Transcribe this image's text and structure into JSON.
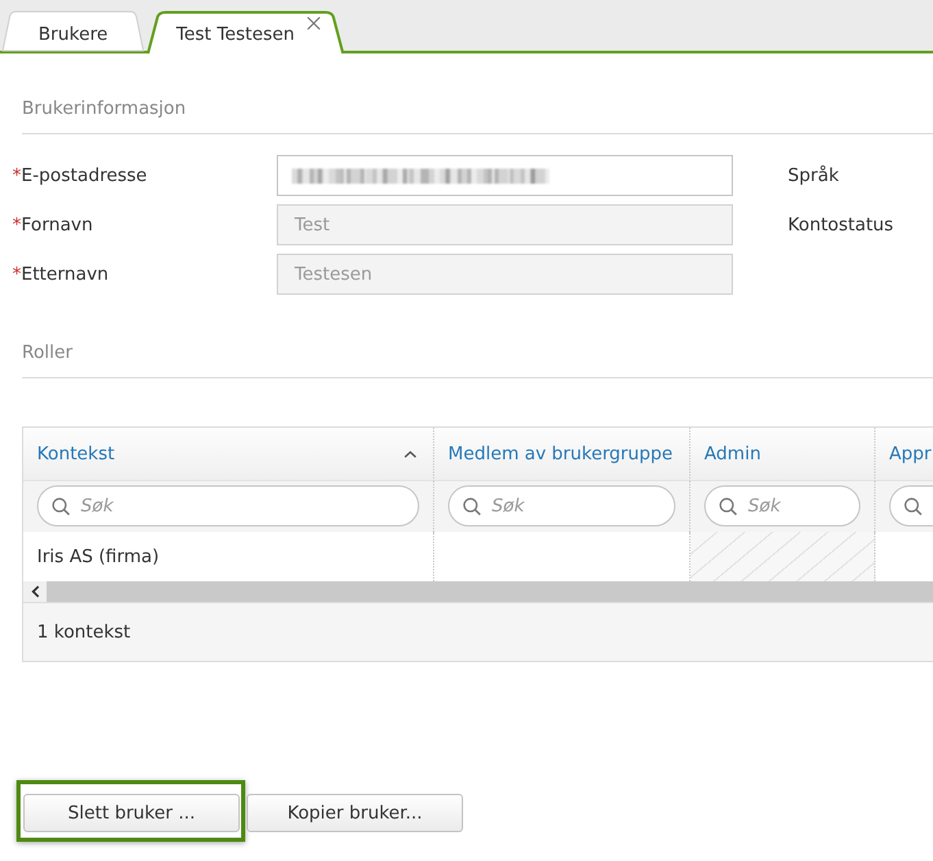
{
  "tabs": [
    {
      "label": "Brukere",
      "selected": false,
      "closable": false
    },
    {
      "label": "Test Testesen",
      "selected": true,
      "closable": true
    }
  ],
  "user_info": {
    "title": "Brukerinformasjon",
    "fields": [
      {
        "label": "E-postadresse",
        "marker": "*",
        "redacted": true,
        "disabled": false
      },
      {
        "label": "Fornavn",
        "marker": "*",
        "value": "Test",
        "redacted": false,
        "disabled": true
      },
      {
        "label": "Etternavn",
        "marker": "*",
        "value": "Testesen",
        "redacted": false,
        "disabled": true
      }
    ],
    "side_labels": [
      "Språk",
      "Kontostatus"
    ]
  },
  "roles": {
    "title": "Roller",
    "table": {
      "columns": [
        {
          "label": "Kontekst",
          "sorted": true,
          "filter_placeholder": "Søk"
        },
        {
          "label": "Medlem av brukergruppe",
          "sorted": false,
          "filter_placeholder": "Søk"
        },
        {
          "label": "Admin",
          "sorted": false,
          "filter_placeholder": "Søk"
        },
        {
          "label": "Appr",
          "sorted": false
        }
      ],
      "rows": [
        {
          "cells": [
            {
              "kind": "text",
              "text": "Iris AS (firma)"
            },
            {
              "kind": "empty"
            },
            {
              "kind": "hatched"
            },
            {
              "kind": "empty"
            }
          ]
        }
      ],
      "footer": "1 kontekst"
    }
  },
  "buttons": [
    {
      "label": "Slett bruker ...",
      "focused": true
    },
    {
      "label": "Kopier bruker...",
      "focused": false
    }
  ]
}
